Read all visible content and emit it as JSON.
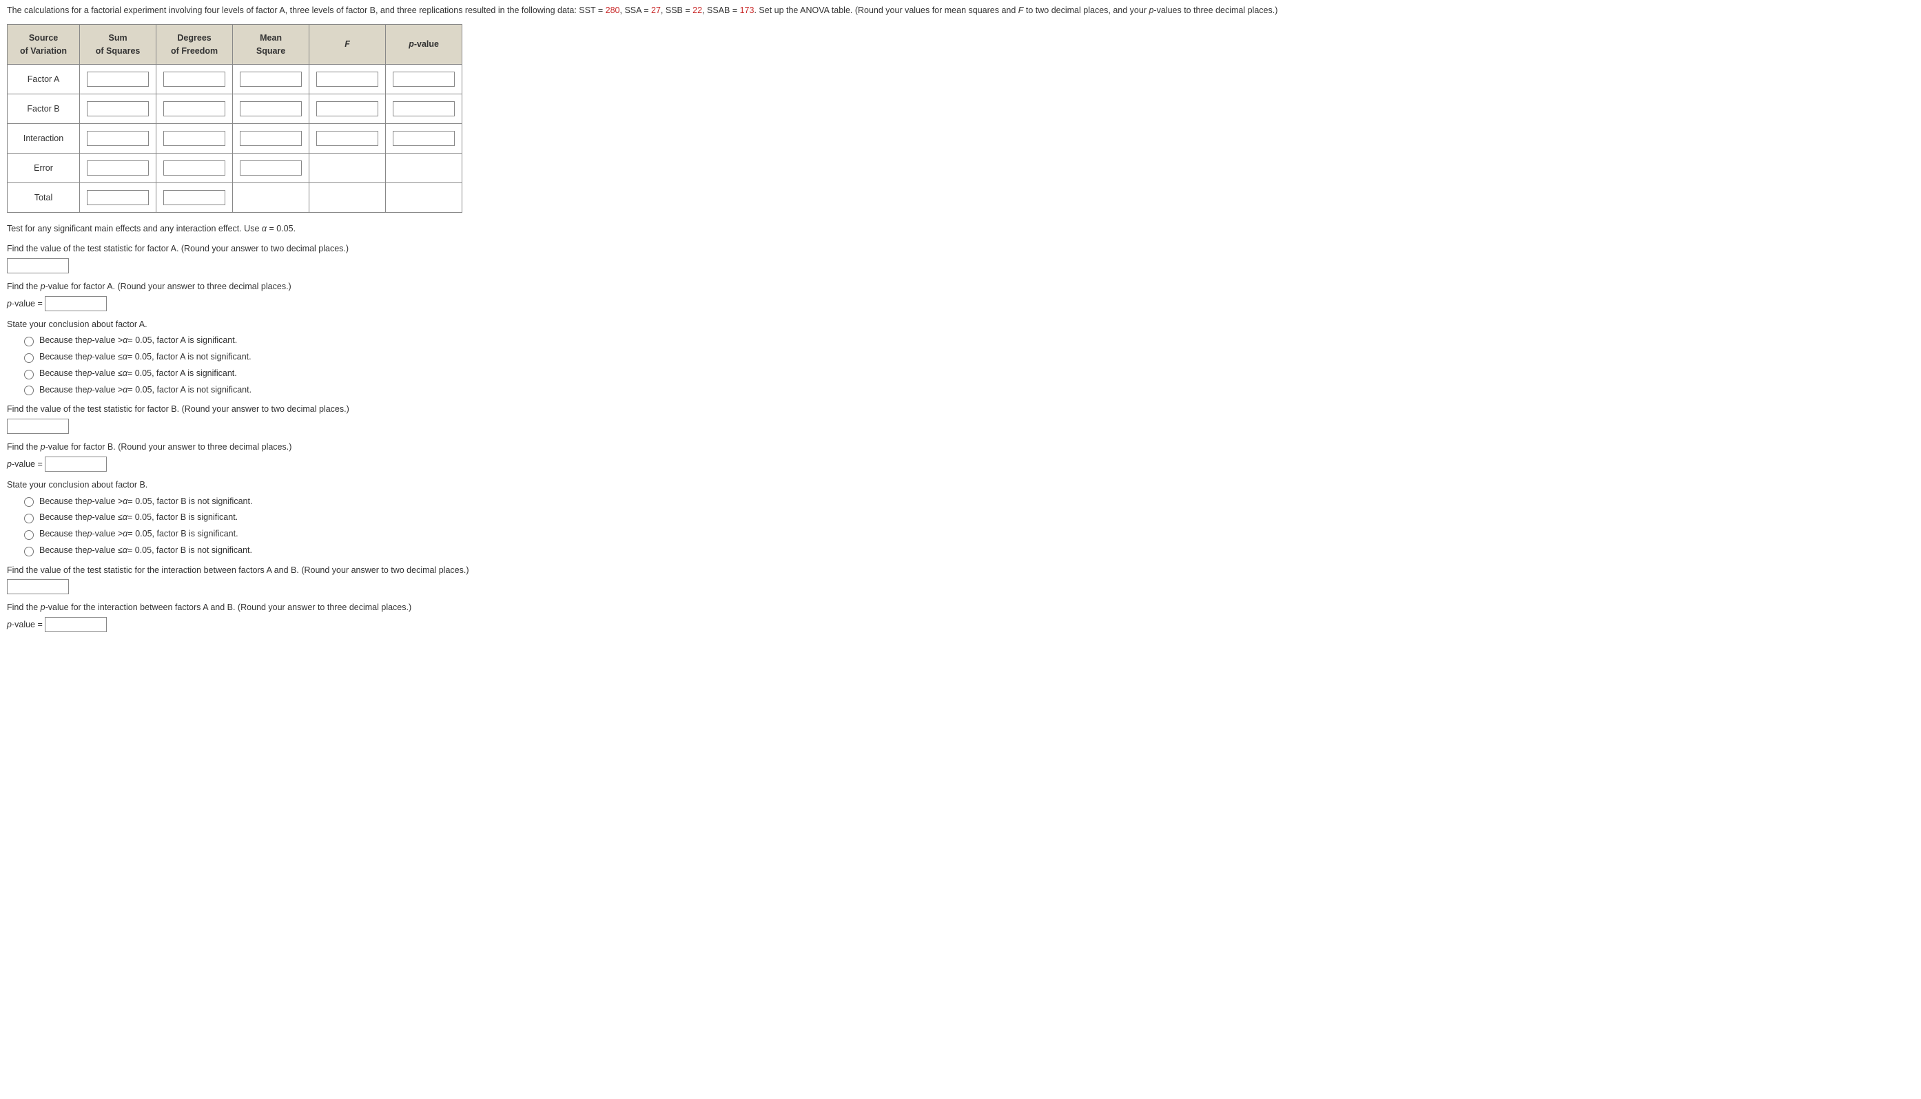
{
  "intro": {
    "prefix": "The calculations for a factorial experiment involving four levels of factor A, three levels of factor B, and three replications resulted in the following data: SST = ",
    "sst": "280",
    "mid1": ", SSA = ",
    "ssa": "27",
    "mid2": ", SSB = ",
    "ssb": "22",
    "mid3": ", SSAB = ",
    "ssab": "173",
    "suffix1": ". Set up the ANOVA table. (Round your values for mean squares and ",
    "suffix2": " to two decimal places, and your ",
    "suffix3": "-values to three decimal places.)",
    "F": "F",
    "p": "p"
  },
  "table": {
    "headers": {
      "source1": "Source",
      "source2": "of Variation",
      "ss1": "Sum",
      "ss2": "of Squares",
      "df1": "Degrees",
      "df2": "of Freedom",
      "ms1": "Mean",
      "ms2": "Square",
      "f": "F",
      "p1": "p",
      "p2": "-value"
    },
    "rows": {
      "factorA": "Factor A",
      "factorB": "Factor B",
      "interaction": "Interaction",
      "error": "Error",
      "total": "Total"
    }
  },
  "instructions": {
    "test_line": "Test for any significant main effects and any interaction effect. Use ",
    "alpha": "α",
    "alpha_eq": " = 0.05.",
    "findA_stat": "Find the value of the test statistic for factor A. (Round your answer to two decimal places.)",
    "findA_p1": "Find the ",
    "findA_p2": "-value for factor A. (Round your answer to three decimal places.)",
    "p": "p",
    "pvalue_eq": "-value = ",
    "conclA": "State your conclusion about factor A.",
    "findB_stat": "Find the value of the test statistic for factor B. (Round your answer to two decimal places.)",
    "findB_p2": "-value for factor B. (Round your answer to three decimal places.)",
    "conclB": "State your conclusion about factor B.",
    "findAB_stat": "Find the value of the test statistic for the interaction between factors A and B. (Round your answer to two decimal places.)",
    "findAB_p2": "-value for the interaction between factors A and B. (Round your answer to three decimal places.)"
  },
  "optionsA": {
    "o1a": "Because the ",
    "o1b": "-value > ",
    "o1c": " = 0.05, factor A is significant.",
    "o2a": "Because the ",
    "o2b": "-value ≤ ",
    "o2c": " = 0.05, factor A is not significant.",
    "o3a": "Because the ",
    "o3b": "-value ≤ ",
    "o3c": " = 0.05, factor A is significant.",
    "o4a": "Because the ",
    "o4b": "-value > ",
    "o4c": " = 0.05, factor A is not significant."
  },
  "optionsB": {
    "o1a": "Because the ",
    "o1b": "-value > ",
    "o1c": " = 0.05, factor B is not significant.",
    "o2a": "Because the ",
    "o2b": "-value ≤ ",
    "o2c": " = 0.05, factor B is significant.",
    "o3a": "Because the ",
    "o3b": "-value > ",
    "o3c": " = 0.05, factor B is significant.",
    "o4a": "Because the ",
    "o4b": "-value ≤ ",
    "o4c": " = 0.05, factor B is not significant."
  }
}
